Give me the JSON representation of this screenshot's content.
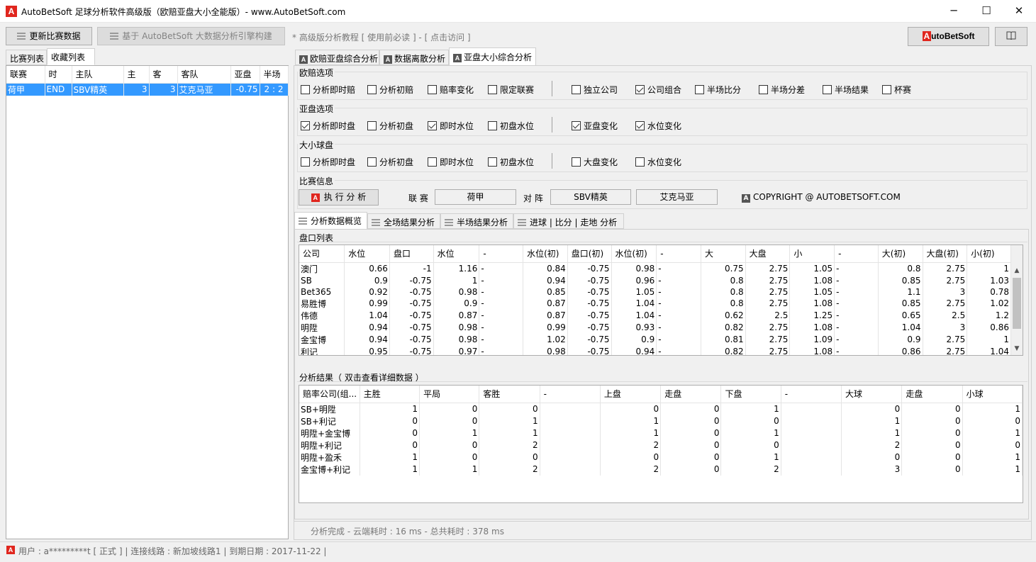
{
  "window": {
    "title": "AutoBetSoft 足球分析软件高级版（欧赔亚盘大小全能版）-  www.AutoBetSoft.com",
    "logo": "A",
    "minimize": "─",
    "maximize": "☐",
    "close": "✕"
  },
  "toolbar": {
    "update_label": "更新比赛数据",
    "engine_label": "基于 AutoBetSoft 大数据分析引擎构建",
    "tutorial_text": "* 高级版分析教程 [ 使用前必读 ] - [ 点击访问 ]",
    "brand_logo_letter": "A",
    "brand_logo_text": "utoBetSoft"
  },
  "left_tabs": [
    {
      "label": "比赛列表"
    },
    {
      "label": "收藏列表"
    }
  ],
  "match_list": {
    "columns": [
      "联赛",
      "时",
      "主队",
      "主",
      "客",
      "客队",
      "亚盘",
      "半场"
    ],
    "rows": [
      [
        "荷甲",
        "END",
        "SBV精英",
        "3",
        "3",
        "艾克马亚",
        "-0.75",
        "2 : 2"
      ]
    ]
  },
  "main_tabs": [
    {
      "label": "欧赔亚盘综合分析"
    },
    {
      "label": "数据离散分析"
    },
    {
      "label": "亚盘大小综合分析"
    }
  ],
  "odds_options": {
    "label": "欧赔选项",
    "items": [
      {
        "label": "分析即时赔",
        "checked": false
      },
      {
        "label": "分析初赔",
        "checked": false
      },
      {
        "label": "赔率变化",
        "checked": false
      },
      {
        "label": "限定联赛",
        "checked": false
      },
      {
        "label": "独立公司",
        "checked": false
      },
      {
        "label": "公司组合",
        "checked": true
      },
      {
        "label": "半场比分",
        "checked": false
      },
      {
        "label": "半场分差",
        "checked": false
      },
      {
        "label": "半场结果",
        "checked": false
      },
      {
        "label": "杯赛",
        "checked": false
      }
    ]
  },
  "asian_options": {
    "label": "亚盘选项",
    "items": [
      {
        "label": "分析即时盘",
        "checked": true
      },
      {
        "label": "分析初盘",
        "checked": false
      },
      {
        "label": "即时水位",
        "checked": true
      },
      {
        "label": "初盘水位",
        "checked": false
      },
      {
        "label": "亚盘变化",
        "checked": true
      },
      {
        "label": "水位变化",
        "checked": true
      }
    ]
  },
  "ou_options": {
    "label": "大小球盘",
    "items": [
      {
        "label": "分析即时盘",
        "checked": false
      },
      {
        "label": "分析初盘",
        "checked": false
      },
      {
        "label": "即时水位",
        "checked": false
      },
      {
        "label": "初盘水位",
        "checked": false
      },
      {
        "label": "大盘变化",
        "checked": false
      },
      {
        "label": "水位变化",
        "checked": false
      }
    ]
  },
  "match_info": {
    "label": "比赛信息",
    "run_label": "执 行 分 析",
    "league_label": "联 赛",
    "league_value": "荷甲",
    "vs_label": "对 阵",
    "home_value": "SBV精英",
    "away_value": "艾克马亚",
    "copyright": "COPYRIGHT @ AUTOBETSOFT.COM"
  },
  "sub_tabs": [
    {
      "label": "分析数据概览"
    },
    {
      "label": "全场结果分析"
    },
    {
      "label": "半场结果分析"
    },
    {
      "label": "进球 | 比分 | 走地 分析"
    }
  ],
  "odds_list": {
    "label": "盘口列表",
    "columns": [
      "公司",
      "水位",
      "盘口",
      "水位",
      "-",
      "水位(初)",
      "盘口(初)",
      "水位(初)",
      "-",
      "大",
      "大盘",
      "小",
      "-",
      "大(初)",
      "大盘(初)",
      "小(初)"
    ],
    "rows": [
      [
        "澳门",
        "0.66",
        "-1",
        "1.16",
        "-",
        "0.84",
        "-0.75",
        "0.98",
        "-",
        "0.75",
        "2.75",
        "1.05",
        "-",
        "0.8",
        "2.75",
        "1"
      ],
      [
        "SB",
        "0.9",
        "-0.75",
        "1",
        "-",
        "0.94",
        "-0.75",
        "0.96",
        "-",
        "0.8",
        "2.75",
        "1.08",
        "-",
        "0.85",
        "2.75",
        "1.03"
      ],
      [
        "Bet365",
        "0.92",
        "-0.75",
        "0.98",
        "-",
        "0.85",
        "-0.75",
        "1.05",
        "-",
        "0.8",
        "2.75",
        "1.05",
        "-",
        "1.1",
        "3",
        "0.78"
      ],
      [
        "易胜博",
        "0.99",
        "-0.75",
        "0.9",
        "-",
        "0.87",
        "-0.75",
        "1.04",
        "-",
        "0.8",
        "2.75",
        "1.08",
        "-",
        "0.85",
        "2.75",
        "1.02"
      ],
      [
        "伟德",
        "1.04",
        "-0.75",
        "0.87",
        "-",
        "0.87",
        "-0.75",
        "1.04",
        "-",
        "0.62",
        "2.5",
        "1.25",
        "-",
        "0.65",
        "2.5",
        "1.2"
      ],
      [
        "明陞",
        "0.94",
        "-0.75",
        "0.98",
        "-",
        "0.99",
        "-0.75",
        "0.93",
        "-",
        "0.82",
        "2.75",
        "1.08",
        "-",
        "1.04",
        "3",
        "0.86"
      ],
      [
        "金宝博",
        "0.94",
        "-0.75",
        "0.98",
        "-",
        "1.02",
        "-0.75",
        "0.9",
        "-",
        "0.81",
        "2.75",
        "1.09",
        "-",
        "0.9",
        "2.75",
        "1"
      ],
      [
        "利记",
        "0.95",
        "-0.75",
        "0.97",
        "-",
        "0.98",
        "-0.75",
        "0.94",
        "-",
        "0.82",
        "2.75",
        "1.08",
        "-",
        "0.86",
        "2.75",
        "1.04"
      ]
    ]
  },
  "results": {
    "label": "分析结果（ 双击查看详细数据 ）",
    "columns": [
      "赔率公司(组...",
      "主胜",
      "平局",
      "客胜",
      "-",
      "上盘",
      "走盘",
      "下盘",
      "-",
      "大球",
      "走盘",
      "小球"
    ],
    "rows": [
      [
        "SB+明陞",
        "1",
        "0",
        "0",
        "",
        "0",
        "0",
        "1",
        "",
        "0",
        "0",
        "1"
      ],
      [
        "SB+利记",
        "0",
        "0",
        "1",
        "",
        "1",
        "0",
        "0",
        "",
        "1",
        "0",
        "0"
      ],
      [
        "明陞+金宝博",
        "0",
        "1",
        "1",
        "",
        "1",
        "0",
        "1",
        "",
        "1",
        "0",
        "1"
      ],
      [
        "明陞+利记",
        "0",
        "0",
        "2",
        "",
        "2",
        "0",
        "0",
        "",
        "2",
        "0",
        "0"
      ],
      [
        "明陞+盈禾",
        "1",
        "0",
        "0",
        "",
        "0",
        "0",
        "1",
        "",
        "0",
        "0",
        "1"
      ],
      [
        "金宝博+利记",
        "1",
        "1",
        "2",
        "",
        "2",
        "0",
        "2",
        "",
        "3",
        "0",
        "1"
      ]
    ]
  },
  "status": {
    "analysis": "分析完成 -  云端耗时 : 16 ms  - 总共耗时 : 378 ms",
    "user": "用户 : a*********t [ 正式 ] | 连接线路 : 新加坡线路1 | 到期日期 : 2017-11-22  |"
  }
}
